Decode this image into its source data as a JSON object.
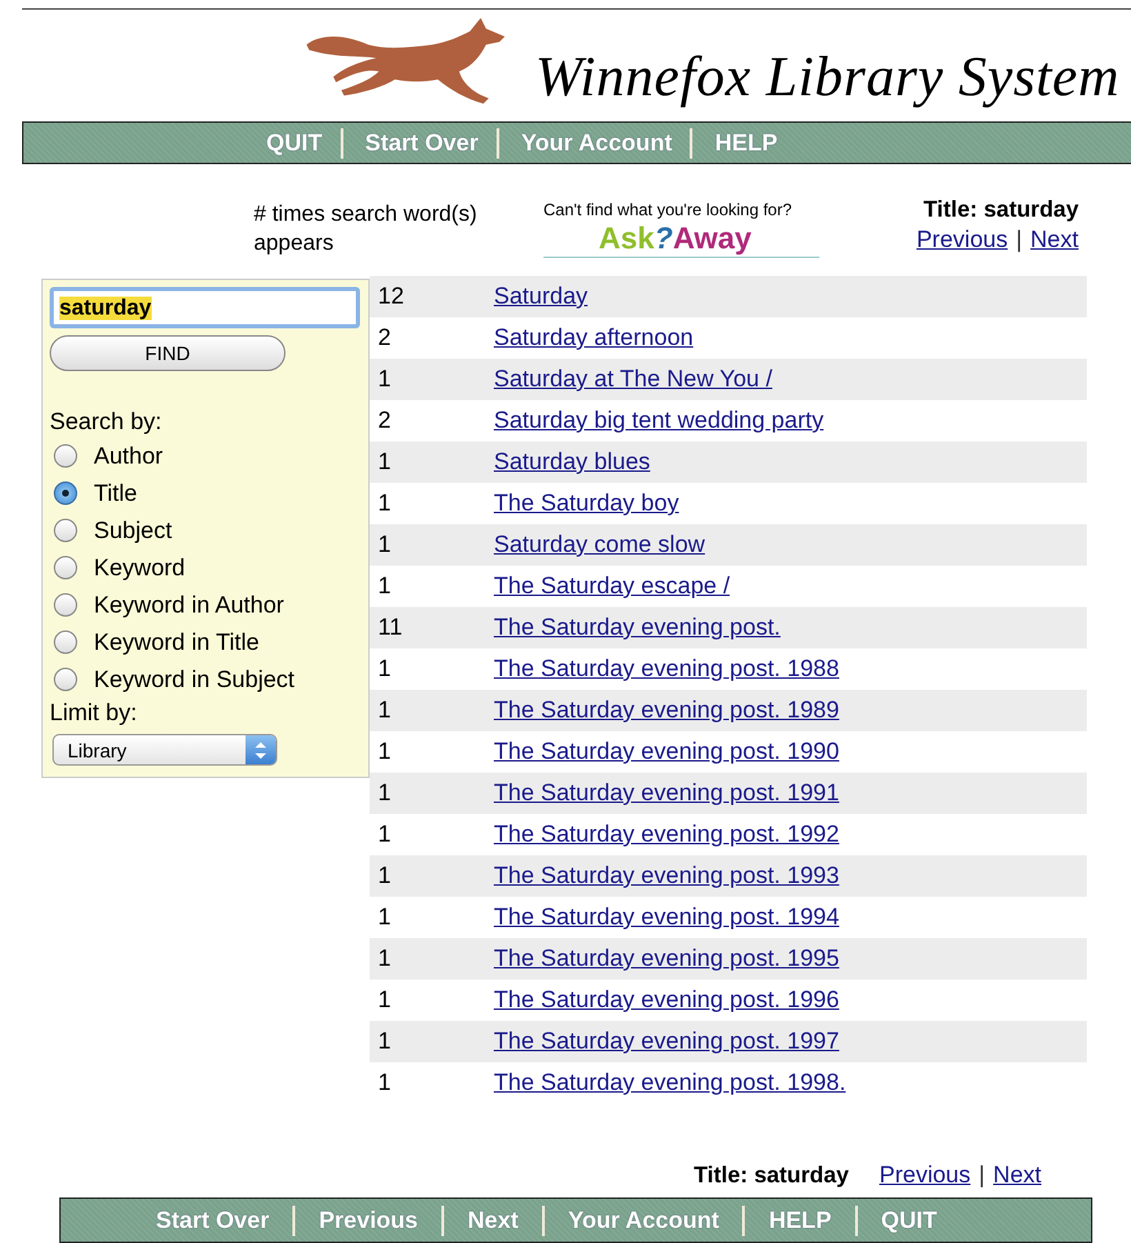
{
  "site_title": "Winnefox Library System",
  "nav_top": [
    {
      "label": "QUIT"
    },
    {
      "label": "Start Over"
    },
    {
      "label": "Your Account"
    },
    {
      "label": "HELP"
    }
  ],
  "header": {
    "count_heading": "# times search word(s) appears",
    "ask_prompt": "Can't find what you're looking for?",
    "ask_logo": {
      "first": "Ask",
      "mark": "?",
      "second": "Away"
    },
    "title_label": "Title: saturday",
    "previous": "Previous",
    "separator": "|",
    "next": "Next"
  },
  "search": {
    "value": "saturday",
    "button": "FIND",
    "search_by_label": "Search by:",
    "options": [
      {
        "label": "Author",
        "selected": false
      },
      {
        "label": "Title",
        "selected": true
      },
      {
        "label": "Subject",
        "selected": false
      },
      {
        "label": "Keyword",
        "selected": false
      },
      {
        "label": "Keyword in Author",
        "selected": false
      },
      {
        "label": "Keyword in Title",
        "selected": false
      },
      {
        "label": "Keyword in Subject",
        "selected": false
      }
    ],
    "limit_label": "Limit by:",
    "limit_value": "Library"
  },
  "results": [
    {
      "count": "12",
      "title": "Saturday"
    },
    {
      "count": "2",
      "title": "Saturday afternoon"
    },
    {
      "count": "1",
      "title": "Saturday at The New You /"
    },
    {
      "count": "2",
      "title": "Saturday big tent wedding party"
    },
    {
      "count": "1",
      "title": "Saturday blues"
    },
    {
      "count": "1",
      "title": "The Saturday boy"
    },
    {
      "count": "1",
      "title": "Saturday come slow"
    },
    {
      "count": "1",
      "title": "The Saturday escape /"
    },
    {
      "count": "11",
      "title": "The Saturday evening post."
    },
    {
      "count": "1",
      "title": "The Saturday evening post. 1988"
    },
    {
      "count": "1",
      "title": "The Saturday evening post. 1989"
    },
    {
      "count": "1",
      "title": "The Saturday evening post. 1990"
    },
    {
      "count": "1",
      "title": "The Saturday evening post. 1991"
    },
    {
      "count": "1",
      "title": "The Saturday evening post. 1992"
    },
    {
      "count": "1",
      "title": "The Saturday evening post. 1993"
    },
    {
      "count": "1",
      "title": "The Saturday evening post. 1994"
    },
    {
      "count": "1",
      "title": "The Saturday evening post. 1995"
    },
    {
      "count": "1",
      "title": "The Saturday evening post. 1996"
    },
    {
      "count": "1",
      "title": "The Saturday evening post. 1997"
    },
    {
      "count": "1",
      "title": "The Saturday evening post. 1998."
    }
  ],
  "footer": {
    "title_label": "Title: saturday",
    "previous": "Previous",
    "separator": "|",
    "next": "Next"
  },
  "nav_bottom": [
    {
      "label": "Start Over"
    },
    {
      "label": "Previous"
    },
    {
      "label": "Next"
    },
    {
      "label": "Your Account"
    },
    {
      "label": "HELP"
    },
    {
      "label": "QUIT"
    }
  ]
}
